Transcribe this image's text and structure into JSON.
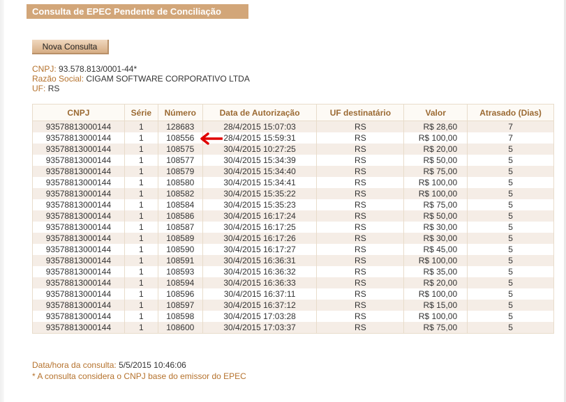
{
  "header": {
    "title": "Consulta de EPEC Pendente de Conciliação",
    "new_query_button": "Nova Consulta"
  },
  "emitter": {
    "cnpj_label": "CNPJ:",
    "cnpj_value": "93.578.813/0001-44*",
    "razao_label": "Razão Social:",
    "razao_value": "CIGAM SOFTWARE CORPORATIVO LTDA",
    "uf_label": "UF:",
    "uf_value": "RS"
  },
  "table": {
    "columns": [
      "CNPJ",
      "Série",
      "Número",
      "Data de Autorização",
      "UF destinatário",
      "Valor",
      "Atrasado (Dias)"
    ],
    "rows": [
      [
        "93578813000144",
        "1",
        "128683",
        "28/4/2015 15:07:03",
        "RS",
        "R$ 28,60",
        "7"
      ],
      [
        "93578813000144",
        "1",
        "108556",
        "28/4/2015 15:59:31",
        "RS",
        "R$ 100,00",
        "7"
      ],
      [
        "93578813000144",
        "1",
        "108575",
        "30/4/2015 10:27:25",
        "RS",
        "R$ 20,00",
        "5"
      ],
      [
        "93578813000144",
        "1",
        "108577",
        "30/4/2015 15:34:39",
        "RS",
        "R$ 50,00",
        "5"
      ],
      [
        "93578813000144",
        "1",
        "108579",
        "30/4/2015 15:34:40",
        "RS",
        "R$ 75,00",
        "5"
      ],
      [
        "93578813000144",
        "1",
        "108580",
        "30/4/2015 15:34:41",
        "RS",
        "R$ 100,00",
        "5"
      ],
      [
        "93578813000144",
        "1",
        "108582",
        "30/4/2015 15:35:22",
        "RS",
        "R$ 100,00",
        "5"
      ],
      [
        "93578813000144",
        "1",
        "108584",
        "30/4/2015 15:35:23",
        "RS",
        "R$ 75,00",
        "5"
      ],
      [
        "93578813000144",
        "1",
        "108586",
        "30/4/2015 16:17:24",
        "RS",
        "R$ 50,00",
        "5"
      ],
      [
        "93578813000144",
        "1",
        "108587",
        "30/4/2015 16:17:25",
        "RS",
        "R$ 30,00",
        "5"
      ],
      [
        "93578813000144",
        "1",
        "108589",
        "30/4/2015 16:17:26",
        "RS",
        "R$ 30,00",
        "5"
      ],
      [
        "93578813000144",
        "1",
        "108590",
        "30/4/2015 16:17:27",
        "RS",
        "R$ 45,00",
        "5"
      ],
      [
        "93578813000144",
        "1",
        "108591",
        "30/4/2015 16:36:31",
        "RS",
        "R$ 100,00",
        "5"
      ],
      [
        "93578813000144",
        "1",
        "108593",
        "30/4/2015 16:36:32",
        "RS",
        "R$ 35,00",
        "5"
      ],
      [
        "93578813000144",
        "1",
        "108594",
        "30/4/2015 16:36:33",
        "RS",
        "R$ 20,00",
        "5"
      ],
      [
        "93578813000144",
        "1",
        "108596",
        "30/4/2015 16:37:11",
        "RS",
        "R$ 100,00",
        "5"
      ],
      [
        "93578813000144",
        "1",
        "108597",
        "30/4/2015 16:37:12",
        "RS",
        "R$ 15,00",
        "5"
      ],
      [
        "93578813000144",
        "1",
        "108598",
        "30/4/2015 17:03:28",
        "RS",
        "R$ 100,00",
        "5"
      ],
      [
        "93578813000144",
        "1",
        "108600",
        "30/4/2015 17:03:37",
        "RS",
        "R$ 75,00",
        "5"
      ]
    ]
  },
  "footer": {
    "query_time_label": "Data/hora da consulta:",
    "query_time_value": "5/5/2015 10:46:06",
    "note": "* A consulta considera o CNPJ base do emissor do EPEC"
  },
  "annotation": {
    "arrow_icon": "left-arrow-icon",
    "arrow_color": "#e00000"
  },
  "colors": {
    "title_bar": "#d2a679",
    "label_accent": "#b5722d",
    "header_text": "#9b6a33",
    "odd_row": "#f5ede6"
  }
}
